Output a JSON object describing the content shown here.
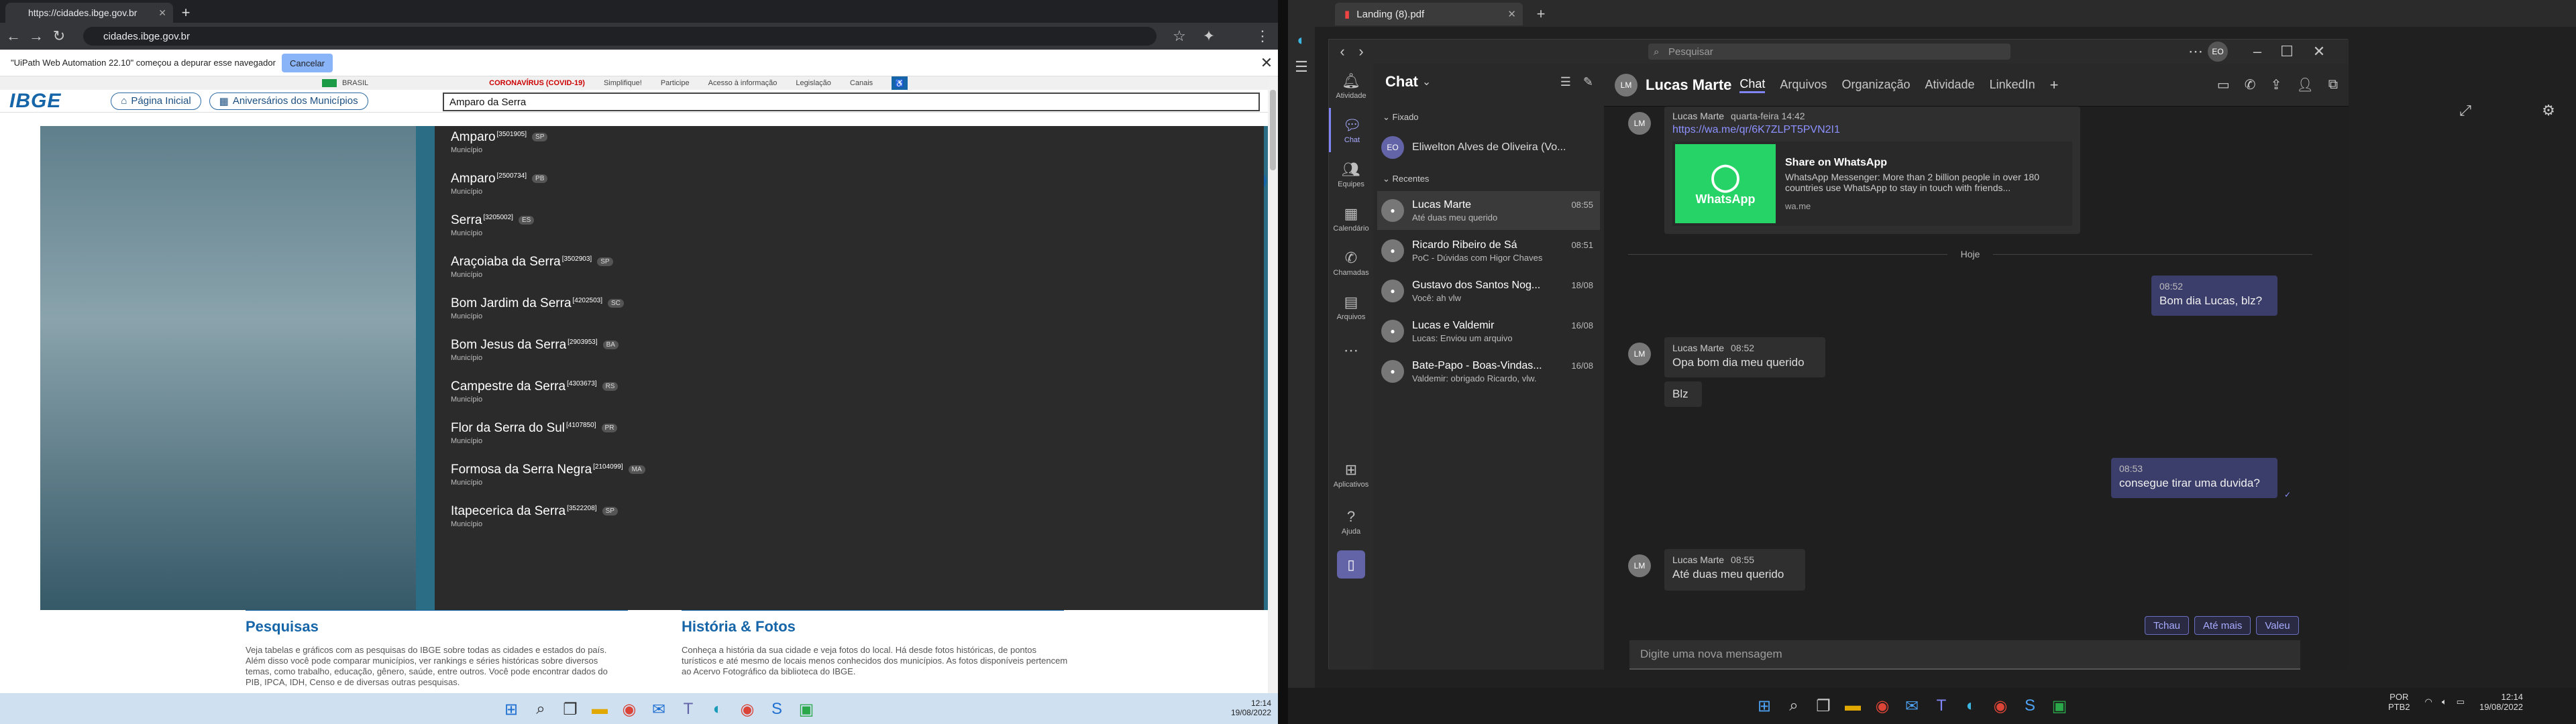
{
  "left": {
    "tab_title": "https://cidades.ibge.gov.br",
    "url": "cidades.ibge.gov.br",
    "debug_text": "\"UiPath Web Automation 22.10\" começou a depurar esse navegador",
    "debug_cancel": "Cancelar",
    "gov_bar": {
      "brasil": "BRASIL",
      "covid": "CORONAVÍRUS (COVID-19)",
      "links": [
        "Simplifique!",
        "Participe",
        "Acesso à informação",
        "Legislação",
        "Canais"
      ]
    },
    "logo": "IBGE",
    "nav": {
      "home": "Página Inicial",
      "anniv": "Aniversários dos Municípios"
    },
    "search_value": "Amparo da Serra",
    "results": [
      {
        "name": "Amparo",
        "code": "[3501905]",
        "uf": "SP",
        "type": "Município"
      },
      {
        "name": "Amparo",
        "code": "[2500734]",
        "uf": "PB",
        "type": "Município"
      },
      {
        "name": "Serra",
        "code": "[3205002]",
        "uf": "ES",
        "type": "Município"
      },
      {
        "name": "Araçoiaba da Serra",
        "code": "[3502903]",
        "uf": "SP",
        "type": "Município"
      },
      {
        "name": "Bom Jardim da Serra",
        "code": "[4202503]",
        "uf": "SC",
        "type": "Município"
      },
      {
        "name": "Bom Jesus da Serra",
        "code": "[2903953]",
        "uf": "BA",
        "type": "Município"
      },
      {
        "name": "Campestre da Serra",
        "code": "[4303673]",
        "uf": "RS",
        "type": "Município"
      },
      {
        "name": "Flor da Serra do Sul",
        "code": "[4107850]",
        "uf": "PR",
        "type": "Município"
      },
      {
        "name": "Formosa da Serra Negra",
        "code": "[2104099]",
        "uf": "MA",
        "type": "Município"
      },
      {
        "name": "Itapecerica da Serra",
        "code": "[3522208]",
        "uf": "SP",
        "type": "Município"
      }
    ],
    "sections": {
      "pesquisas_title": "Pesquisas",
      "pesquisas_text": "Veja tabelas e gráficos com as pesquisas do IBGE sobre todas as cidades e estados do país. Além disso você pode comparar municípios, ver rankings e séries históricas sobre diversos temas, como trabalho, educação, gênero, saúde, entre outros. Você pode encontrar dados do PIB, IPCA, IDH, Censo e de diversas outras pesquisas.",
      "historia_title": "História & Fotos",
      "historia_text": "Conheça a história da sua cidade e veja fotos do local. Há desde fotos históricas, de pontos turísticos e até mesmo de locais menos conhecidos dos municípios. As fotos disponíveis pertencem ao Acervo Fotográfico da biblioteca do IBGE."
    },
    "clock": {
      "time": "12:14",
      "date": "19/08/2022"
    }
  },
  "right": {
    "tab_title": "Landing (8).pdf",
    "search_placeholder": "Pesquisar",
    "me_initials": "EO",
    "rail": [
      "Atividade",
      "Chat",
      "Equipes",
      "Calendário",
      "Chamadas",
      "Arquivos",
      "Aplicativos",
      "Ajuda"
    ],
    "chat_header": "Chat",
    "pinned_label": "Fixado",
    "recent_label": "Recentes",
    "pinned": [
      {
        "name": "Eliwelton Alves de Oliveira (Vo...",
        "initials": "EO"
      }
    ],
    "chats": [
      {
        "name": "Lucas Marte",
        "preview": "Até duas meu querido",
        "time": "08:55"
      },
      {
        "name": "Ricardo Ribeiro de Sá",
        "preview": "PoC - Dúvidas com Higor Chaves",
        "time": "08:51"
      },
      {
        "name": "Gustavo dos Santos Nog...",
        "preview": "Você: ah vlw",
        "time": "18/08"
      },
      {
        "name": "Lucas e Valdemir",
        "preview": "Lucas: Enviou um arquivo",
        "time": "16/08"
      },
      {
        "name": "Bate-Papo - Boas-Vindas...",
        "preview": "Valdemir: obrigado Ricardo, vlw.",
        "time": "16/08"
      }
    ],
    "conv": {
      "name": "Lucas Marte",
      "tabs": [
        "Chat",
        "Arquivos",
        "Organização",
        "Atividade",
        "LinkedIn"
      ],
      "first_sender": "Lucas Marte",
      "first_time": "quarta-feira 14:42",
      "link": "https://wa.me/qr/6K7ZLPT5PVN2I1",
      "card_title": "Share on WhatsApp",
      "card_text": "WhatsApp Messenger: More than 2 billion people in over 180 countries use WhatsApp to stay in touch with friends...",
      "card_domain": "wa.me",
      "card_logo": "WhatsApp",
      "day": "Hoje",
      "m1_time": "08:52",
      "m1": "Bom dia Lucas, blz?",
      "m2_sender": "Lucas Marte",
      "m2_time": "08:52",
      "m2": "Opa bom dia meu querido",
      "m2b": "Blz",
      "m3_time": "08:53",
      "m3": "consegue tirar uma duvida?",
      "m4_sender": "Lucas Marte",
      "m4_time": "08:55",
      "m4": "Até duas meu querido",
      "quick_replies": [
        "Tchau",
        "Até mais",
        "Valeu"
      ],
      "compose": "Digite uma nova mensagem"
    },
    "tray": {
      "lang1": "POR",
      "lang2": "PTB2",
      "time": "12:14",
      "date": "19/08/2022"
    }
  }
}
